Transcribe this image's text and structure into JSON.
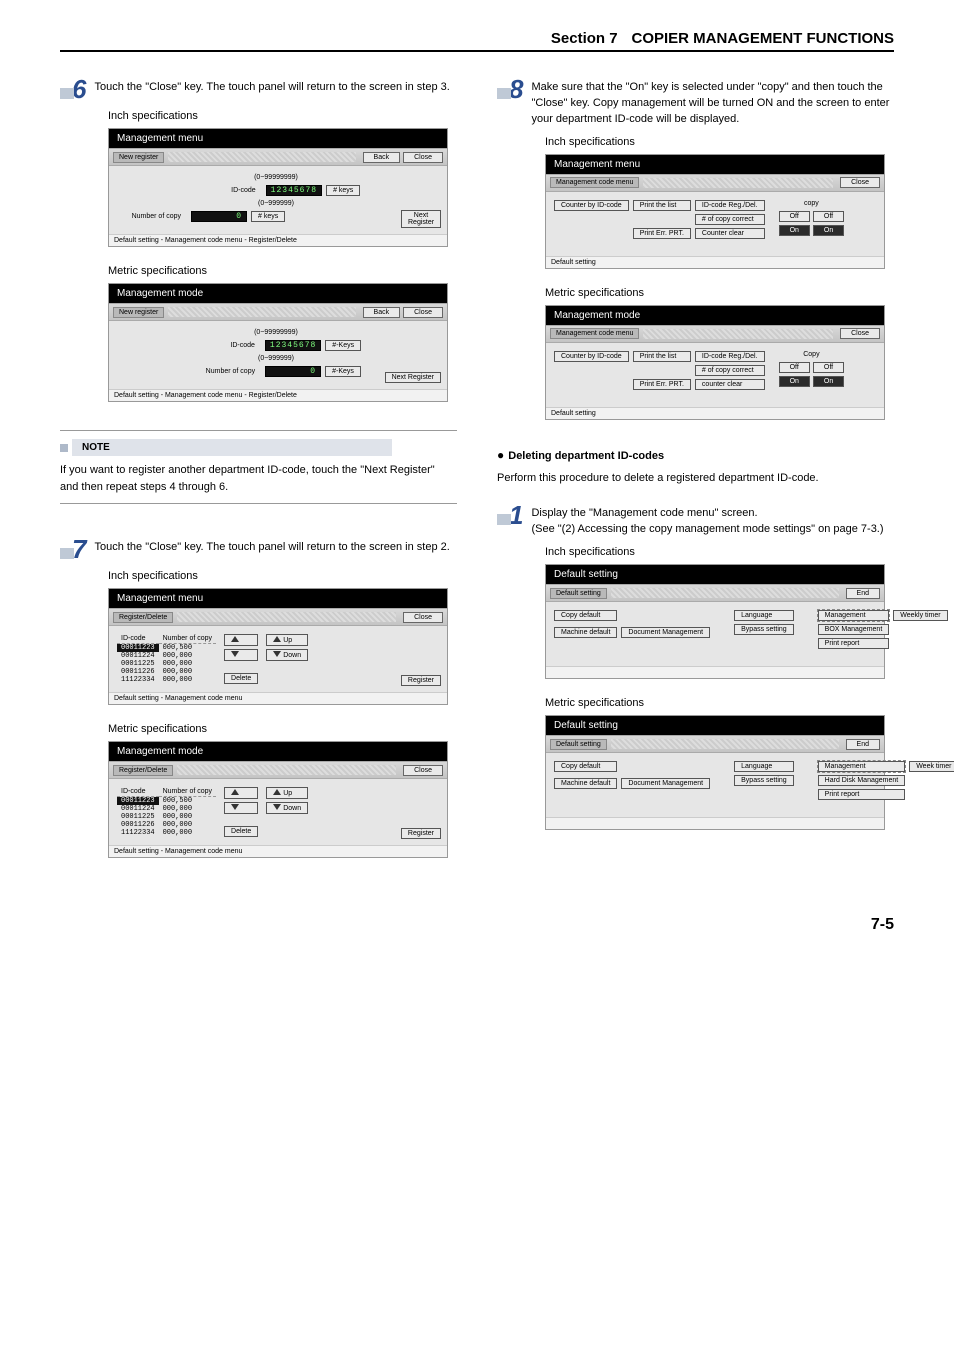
{
  "header": {
    "section": "Section 7",
    "title": "COPIER MANAGEMENT FUNCTIONS"
  },
  "page_number": "7-5",
  "left": {
    "step6": {
      "num": "6",
      "text": "Touch the \"Close\" key. The touch panel will return to the screen in step 3."
    },
    "spec_inch": "Inch specifications",
    "spec_metric": "Metric specifications",
    "ui_newreg_inch": {
      "title": "Management menu",
      "ribbon_label": "New register",
      "back": "Back",
      "close": "Close",
      "range1": "(0~99999999)",
      "idcode_lbl": "ID-code",
      "idcode_val": "12345678",
      "keys1": "# keys",
      "range2": "(0~999999)",
      "numcopy_lbl": "Number of copy",
      "numcopy_val": "0",
      "keys2": "# keys",
      "next": "Next Register",
      "footer": "Default setting - Management code menu - Register/Delete"
    },
    "ui_newreg_metric": {
      "title": "Management mode",
      "ribbon_label": "New register",
      "back": "Back",
      "close": "Close",
      "range1": "(0~99999999)",
      "idcode_lbl": "ID-code",
      "idcode_val": "12345678",
      "keys1": "#-Keys",
      "range2": "(0~999999)",
      "numcopy_lbl": "Number of copy",
      "numcopy_val": "0",
      "keys2": "#-Keys",
      "next": "Next Register",
      "footer": "Default setting - Management code menu - Register/Delete"
    },
    "note": {
      "label": "NOTE",
      "body": "If you want to register another department ID-code, touch the \"Next Register\" and then repeat steps 4 through 6."
    },
    "step7": {
      "num": "7",
      "text": "Touch the \"Close\" key. The touch panel will return to the screen in step 2."
    },
    "ui_regdel_inch": {
      "title": "Management menu",
      "ribbon_label": "Register/Delete",
      "close": "Close",
      "col_id": "ID-code",
      "col_num": "Number of copy",
      "rows": [
        {
          "id": "00011223",
          "n": "000,500"
        },
        {
          "id": "00011224",
          "n": "000,000"
        },
        {
          "id": "00011225",
          "n": "000,000"
        },
        {
          "id": "00011226",
          "n": "000,000"
        },
        {
          "id": "11122334",
          "n": "000,000"
        }
      ],
      "up": "Up",
      "down": "Down",
      "delete": "Delete",
      "register": "Register",
      "footer": "Default setting - Management code menu"
    },
    "ui_regdel_metric": {
      "title": "Management mode",
      "ribbon_label": "Register/Delete",
      "close": "Close",
      "col_id": "ID-code",
      "col_num": "Number of copy",
      "rows": [
        {
          "id": "00011223",
          "n": "000,500"
        },
        {
          "id": "00011224",
          "n": "000,000"
        },
        {
          "id": "00011225",
          "n": "000,000"
        },
        {
          "id": "00011226",
          "n": "000,000"
        },
        {
          "id": "11122334",
          "n": "000,000"
        }
      ],
      "up": "Up",
      "down": "Down",
      "delete": "Delete",
      "register": "Register",
      "footer": "Default setting - Management code menu"
    }
  },
  "right": {
    "step8": {
      "num": "8",
      "text": "Make sure that the \"On\" key is selected under \"copy\" and then touch the \"Close\" key. Copy management will be turned ON and the screen to enter your department ID-code will be displayed."
    },
    "spec_inch": "Inch specifications",
    "spec_metric": "Metric specifications",
    "ui_mgmt_inch": {
      "title": "Management menu",
      "ribbon_label": "Management code menu",
      "close": "Close",
      "btns": {
        "counter": "Counter by ID-code",
        "printlist": "Print the list",
        "idreg": "ID-code Reg./Del.",
        "numcorr": "# of copy correct",
        "printerr": "Print Err. PRT.",
        "cntclear": "Counter clear"
      },
      "copy_lbl": "copy",
      "off": "Off",
      "on": "On",
      "footer": "Default setting"
    },
    "ui_mgmt_metric": {
      "title": "Management mode",
      "ribbon_label": "Management code menu",
      "close": "Close",
      "btns": {
        "counter": "Counter by ID-code",
        "printlist": "Print the list",
        "idreg": "ID-code Reg./Del.",
        "numcorr": "# of copy correct",
        "printerr": "Print Err. PRT.",
        "cntclear": "counter clear"
      },
      "copy_lbl": "Copy",
      "off": "Off",
      "on": "On",
      "footer": "Default setting"
    },
    "del_heading": "Deleting department ID-codes",
    "del_intro": "Perform this procedure to delete a registered department ID-code.",
    "step1": {
      "num": "1",
      "line1": "Display the \"Management code menu\" screen.",
      "line2": "(See \"(2) Accessing the copy management mode settings\" on page 7-3.)"
    },
    "ui_def_inch": {
      "title": "Default setting",
      "ribbon_label": "Default setting",
      "end": "End",
      "btns": {
        "copydef": "Copy default",
        "lang": "Language",
        "bypass": "Bypass setting",
        "mgmt": "Management",
        "timer": "Weekly timer",
        "bdb": "BOX Management",
        "machdef": "Machine default",
        "docmgmt": "Document Management",
        "printrep": "Print report"
      }
    },
    "ui_def_metric": {
      "title": "Default setting",
      "ribbon_label": "Default setting",
      "end": "End",
      "btns": {
        "copydef": "Copy default",
        "lang": "Language",
        "bypass": "Bypass setting",
        "mgmt": "Management",
        "timer": "Week timer",
        "bdb": "Hard Disk Management",
        "machdef": "Machine default",
        "docmgmt": "Document Management",
        "printrep": "Print report"
      }
    }
  }
}
